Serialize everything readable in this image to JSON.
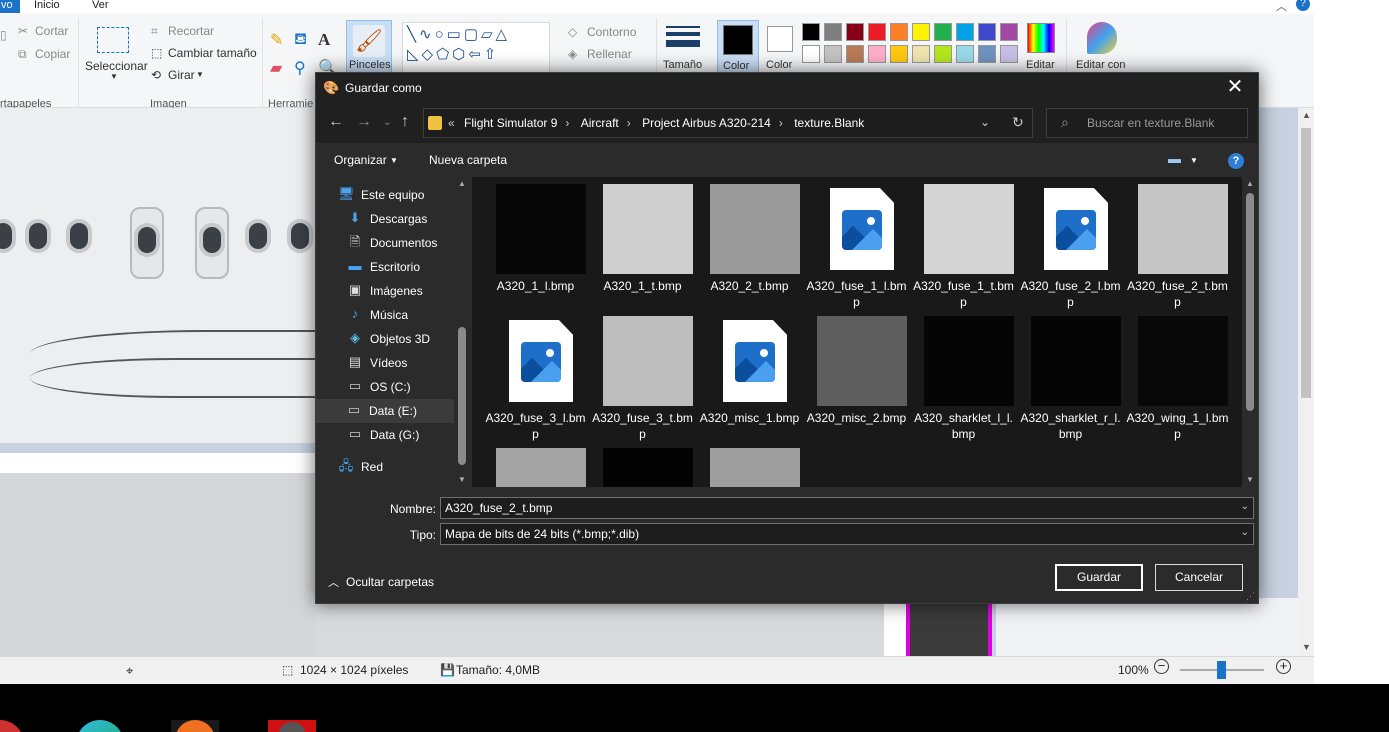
{
  "paint": {
    "menu": [
      "vo",
      "Inicio",
      "Ver"
    ],
    "ribbon": {
      "cortar": "Cortar",
      "copiar": "Copiar",
      "seleccionar": "Seleccionar",
      "recortar": "Recortar",
      "cambiar_tamano": "Cambiar tamaño",
      "girar": "Girar",
      "pinceles": "Pinceles",
      "contorno": "Contorno",
      "rellenar": "Rellenar",
      "tamano": "Tamaño",
      "color1": "Color",
      "color2": "Color",
      "editar_colores": "Editar",
      "editar_con": "Editar con",
      "groups": {
        "portapapeles": "rtapapeles",
        "imagen": "Imagen",
        "herramientas": "Herramie"
      }
    },
    "palette": [
      "#000000",
      "#7f7f7f",
      "#880015",
      "#ed1c24",
      "#ff7f27",
      "#fff200",
      "#22b14c",
      "#00a2e8",
      "#3f48cc",
      "#a349a4",
      "#ffffff",
      "#c3c3c3",
      "#b97a57",
      "#ffaec9",
      "#ffc90e",
      "#efe4b0",
      "#b5e61d",
      "#99d9ea",
      "#7092be",
      "#c8bfe7"
    ],
    "status": {
      "dimensions": "1024 × 1024 píxeles",
      "size": "Tamaño: 4,0MB",
      "zoom": "100%"
    }
  },
  "dialog": {
    "title": "Guardar como",
    "breadcrumb": [
      "Flight Simulator 9",
      "Aircraft",
      "Project Airbus A320-214",
      "texture.Blank"
    ],
    "search_placeholder": "Buscar en texture.Blank",
    "organize": "Organizar",
    "new_folder": "Nueva carpeta",
    "nav_items": [
      {
        "label": "Este equipo",
        "icon": "pc-icon"
      },
      {
        "label": "Descargas",
        "icon": "downloads-icon"
      },
      {
        "label": "Documentos",
        "icon": "documents-icon"
      },
      {
        "label": "Escritorio",
        "icon": "desktop-icon"
      },
      {
        "label": "Imágenes",
        "icon": "pictures-icon"
      },
      {
        "label": "Música",
        "icon": "music-icon"
      },
      {
        "label": "Objetos 3D",
        "icon": "3d-objects-icon"
      },
      {
        "label": "Vídeos",
        "icon": "videos-icon"
      },
      {
        "label": "OS (C:)",
        "icon": "drive-icon"
      },
      {
        "label": "Data (E:)",
        "icon": "drive-icon"
      },
      {
        "label": "Data (G:)",
        "icon": "drive-icon"
      },
      {
        "label": "Red",
        "icon": "network-icon"
      }
    ],
    "files": [
      {
        "name": "A320_1_l.bmp",
        "thumb": "#070707"
      },
      {
        "name": "A320_1_t.bmp",
        "thumb": "#cfcfcf"
      },
      {
        "name": "A320_2_t.bmp",
        "thumb": "#9b9b9b"
      },
      {
        "name": "A320_fuse_1_l.bmp",
        "thumb": "file-icon"
      },
      {
        "name": "A320_fuse_1_t.bmp",
        "thumb": "#d4d4d4"
      },
      {
        "name": "A320_fuse_2_l.bmp",
        "thumb": "file-icon"
      },
      {
        "name": "A320_fuse_2_t.bmp",
        "thumb": "#c6c6c6"
      },
      {
        "name": "A320_fuse_3_l.bmp",
        "thumb": "file-icon"
      },
      {
        "name": "A320_fuse_3_t.bmp",
        "thumb": "#bdbdbd"
      },
      {
        "name": "A320_misc_1.bmp",
        "thumb": "file-icon"
      },
      {
        "name": "A320_misc_2.bmp",
        "thumb": "#5e5e5e"
      },
      {
        "name": "A320_sharklet_l_l.bmp",
        "thumb": "#050505"
      },
      {
        "name": "A320_sharklet_r_l.bmp",
        "thumb": "#050505"
      },
      {
        "name": "A320_wing_1_l.bmp",
        "thumb": "#080808"
      },
      {
        "name": "",
        "thumb": "#a3a3a3"
      },
      {
        "name": "",
        "thumb": "#030303"
      },
      {
        "name": "",
        "thumb": "#9e9e9e"
      }
    ],
    "filename_label": "Nombre:",
    "filename_value": "A320_fuse_2_t.bmp",
    "type_label": "Tipo:",
    "type_value": "Mapa de bits de 24 bits (*.bmp;*.dib)",
    "hide_folders": "Ocultar carpetas",
    "save": "Guardar",
    "cancel": "Cancelar"
  }
}
